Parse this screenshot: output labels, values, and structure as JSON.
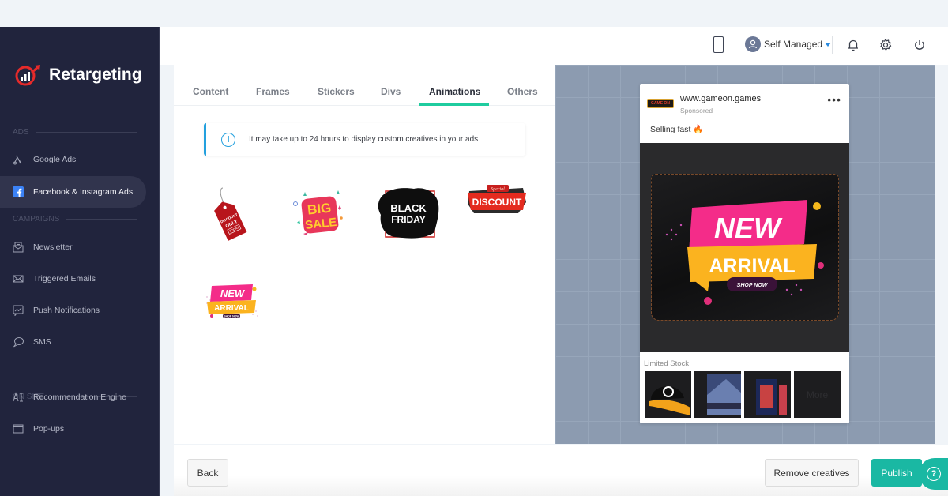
{
  "app": {
    "brand": "Retargeting"
  },
  "sidebar": {
    "sections": [
      {
        "label": "ADS"
      },
      {
        "label": "CAMPAIGNS"
      },
      {
        "label": "ON SITE"
      }
    ],
    "items": [
      {
        "label": "Google Ads",
        "icon": "google-ads-icon"
      },
      {
        "label": "Facebook & Instagram Ads",
        "icon": "facebook-icon",
        "active": true
      },
      {
        "label": "Newsletter",
        "icon": "newsletter-icon"
      },
      {
        "label": "Triggered Emails",
        "icon": "envelope-icon"
      },
      {
        "label": "Push Notifications",
        "icon": "push-notification-icon"
      },
      {
        "label": "SMS",
        "icon": "chat-bubble-icon"
      },
      {
        "label": "Recommendation Engine",
        "icon": "ai-icon"
      },
      {
        "label": "Pop-ups",
        "icon": "window-icon"
      }
    ]
  },
  "topbar": {
    "account_label": "Self Managed",
    "icons": [
      "mobile-preview-icon",
      "user-avatar-icon",
      "bell-icon",
      "gear-icon",
      "power-icon"
    ]
  },
  "editor": {
    "tabs": [
      {
        "label": "Content"
      },
      {
        "label": "Frames"
      },
      {
        "label": "Stickers"
      },
      {
        "label": "Divs"
      },
      {
        "label": "Animations",
        "active": true
      },
      {
        "label": "Others"
      }
    ],
    "info_message": "It may take up to 24 hours to display custom creatives in your ads",
    "animations": [
      {
        "name": "discount-only-today-tag",
        "text": [
          "DISCOUNT",
          "ONLY",
          "TODAY"
        ]
      },
      {
        "name": "big-sale",
        "text": [
          "BIG",
          "SALE"
        ]
      },
      {
        "name": "black-friday",
        "text": [
          "BLACK",
          "FRIDAY"
        ]
      },
      {
        "name": "special-discount",
        "text": [
          "Special",
          "DISCOUNT"
        ]
      },
      {
        "name": "new-arrival",
        "text": [
          "NEW",
          "ARRIVAL",
          "SHOP NOW"
        ]
      }
    ]
  },
  "preview": {
    "brand_logo_text": "GAME ON",
    "site": "www.gameon.games",
    "sponsored": "Sponsored",
    "caption": "Selling fast 🔥",
    "overlay": {
      "line1": "NEW",
      "line2": "ARRIVAL",
      "cta": "SHOP NOW"
    },
    "section_label": "Limited Stock",
    "thumbnails": [
      {
        "name": "cap-product"
      },
      {
        "name": "avengers-product"
      },
      {
        "name": "borderlands-product"
      },
      {
        "name": "more",
        "label": "More"
      }
    ]
  },
  "footer": {
    "back_label": "Back",
    "remove_label": "Remove creatives",
    "publish_label": "Publish",
    "help_label": "?"
  },
  "colors": {
    "sidebar_bg": "#21243d",
    "accent_teal": "#1ab8a3",
    "tab_underline": "#1fcc9f",
    "info_blue": "#23a0de",
    "preview_bg": "#8c9bb0"
  }
}
